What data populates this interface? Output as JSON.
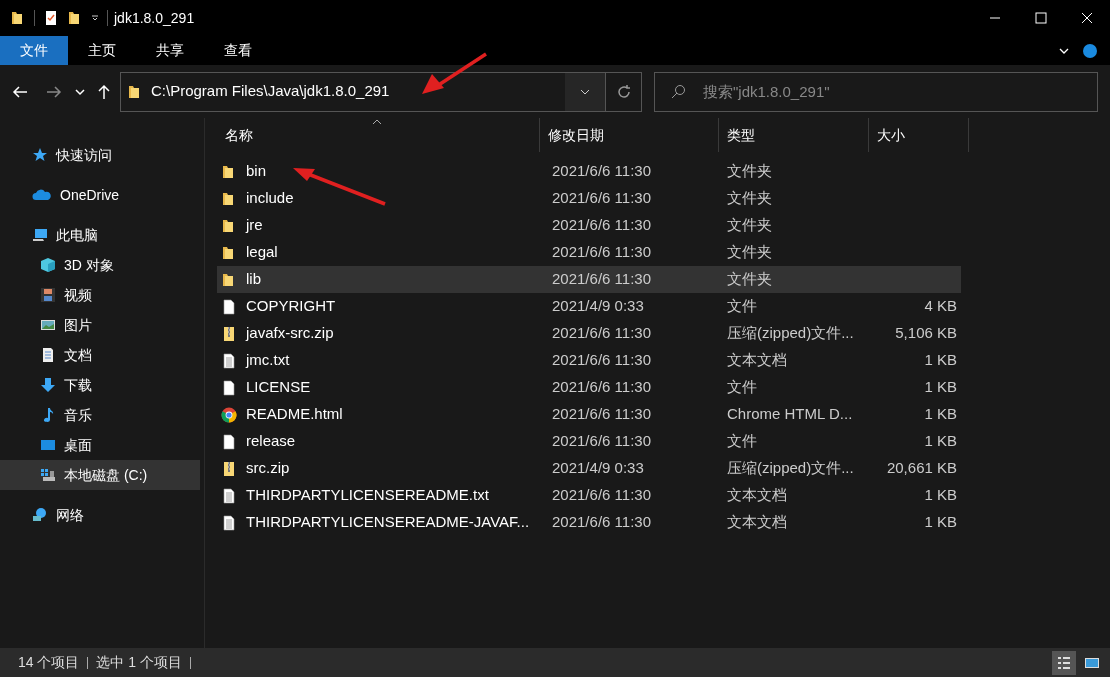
{
  "window": {
    "title": "jdk1.8.0_291"
  },
  "ribbon_tabs": [
    {
      "label": "文件",
      "selected": true
    },
    {
      "label": "主页",
      "selected": false
    },
    {
      "label": "共享",
      "selected": false
    },
    {
      "label": "查看",
      "selected": false
    }
  ],
  "address_bar": {
    "path": "C:\\Program Files\\Java\\jdk1.8.0_291"
  },
  "search": {
    "placeholder": "搜索\"jdk1.8.0_291\""
  },
  "sidebar": {
    "items": [
      {
        "label": "快速访问",
        "kind": "star",
        "selected": false
      },
      {
        "label": "OneDrive",
        "kind": "cloud",
        "selected": false
      },
      {
        "label": "此电脑",
        "kind": "pc",
        "selected": false,
        "children": [
          {
            "label": "3D 对象",
            "kind": "cube",
            "selected": false
          },
          {
            "label": "视频",
            "kind": "film",
            "selected": false
          },
          {
            "label": "图片",
            "kind": "picture",
            "selected": false
          },
          {
            "label": "文档",
            "kind": "doc",
            "selected": false
          },
          {
            "label": "下载",
            "kind": "download",
            "selected": false
          },
          {
            "label": "音乐",
            "kind": "music",
            "selected": false
          },
          {
            "label": "桌面",
            "kind": "desktop",
            "selected": false
          },
          {
            "label": "本地磁盘 (C:)",
            "kind": "drive",
            "selected": true
          }
        ]
      },
      {
        "label": "网络",
        "kind": "network",
        "selected": false
      }
    ]
  },
  "table": {
    "columns": [
      "名称",
      "修改日期",
      "类型",
      "大小"
    ],
    "rows": [
      {
        "name": "bin",
        "date": "2021/6/6 11:30",
        "type": "文件夹",
        "kind": "folder",
        "selected": false
      },
      {
        "name": "include",
        "date": "2021/6/6 11:30",
        "type": "文件夹",
        "kind": "folder",
        "selected": false
      },
      {
        "name": "jre",
        "date": "2021/6/6 11:30",
        "type": "文件夹",
        "kind": "folder",
        "selected": false
      },
      {
        "name": "legal",
        "date": "2021/6/6 11:30",
        "type": "文件夹",
        "kind": "folder",
        "selected": false
      },
      {
        "name": "lib",
        "date": "2021/6/6 11:30",
        "type": "文件夹",
        "kind": "folder",
        "selected": true
      },
      {
        "name": "COPYRIGHT",
        "date": "2021/4/9 0:33",
        "type": "文件",
        "size": "4 KB",
        "kind": "file",
        "selected": false
      },
      {
        "name": "javafx-src.zip",
        "date": "2021/6/6 11:30",
        "type": "压缩(zipped)文件...",
        "size": "5,106 KB",
        "kind": "zip",
        "selected": false
      },
      {
        "name": "jmc.txt",
        "date": "2021/6/6 11:30",
        "type": "文本文档",
        "size": "1 KB",
        "kind": "text",
        "selected": false
      },
      {
        "name": "LICENSE",
        "date": "2021/6/6 11:30",
        "type": "文件",
        "size": "1 KB",
        "kind": "file",
        "selected": false
      },
      {
        "name": "README.html",
        "date": "2021/6/6 11:30",
        "type": "Chrome HTML D...",
        "size": "1 KB",
        "kind": "chrome",
        "selected": false
      },
      {
        "name": "release",
        "date": "2021/6/6 11:30",
        "type": "文件",
        "size": "1 KB",
        "kind": "file",
        "selected": false
      },
      {
        "name": "src.zip",
        "date": "2021/4/9 0:33",
        "type": "压缩(zipped)文件...",
        "size": "20,661 KB",
        "kind": "zip",
        "selected": false
      },
      {
        "name": "THIRDPARTYLICENSEREADME.txt",
        "date": "2021/6/6 11:30",
        "type": "文本文档",
        "size": "1 KB",
        "kind": "text",
        "selected": false
      },
      {
        "name": "THIRDPARTYLICENSEREADME-JAVAF...",
        "date": "2021/6/6 11:30",
        "type": "文本文档",
        "size": "1 KB",
        "kind": "text",
        "selected": false
      }
    ]
  },
  "status_bar": {
    "item_count": "14 个项目",
    "selection": "选中 1 个项目"
  }
}
